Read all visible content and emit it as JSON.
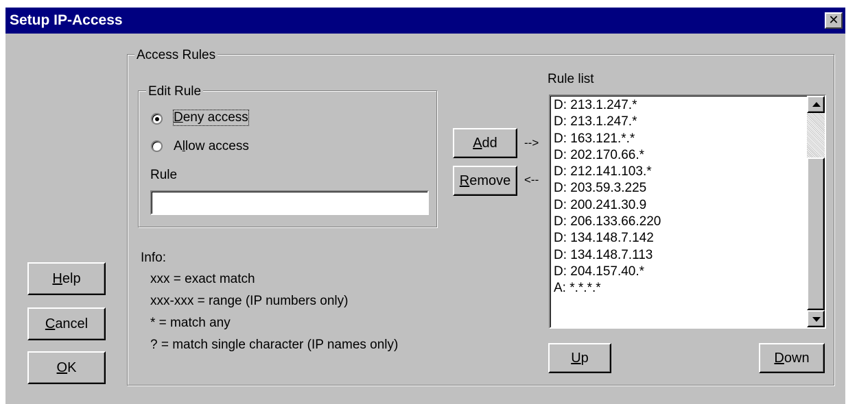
{
  "window": {
    "title": "Setup IP-Access",
    "close_glyph": "✕"
  },
  "buttons": {
    "help": {
      "pre": "",
      "accel": "H",
      "post": "elp"
    },
    "cancel": {
      "pre": "",
      "accel": "C",
      "post": "ancel"
    },
    "ok": {
      "pre": "",
      "accel": "O",
      "post": "K"
    },
    "add": {
      "pre": "",
      "accel": "A",
      "post": "dd"
    },
    "remove": {
      "pre": "",
      "accel": "R",
      "post": "emove"
    },
    "up": {
      "pre": "",
      "accel": "U",
      "post": "p"
    },
    "down": {
      "pre": "",
      "accel": "D",
      "post": "own"
    }
  },
  "access_rules": {
    "label": "Access Rules",
    "edit_rule": {
      "label": "Edit Rule",
      "deny": {
        "pre": "",
        "accel": "D",
        "post": "eny access",
        "selected": true
      },
      "allow": {
        "pre": "A",
        "accel": "l",
        "post": "low access",
        "selected": false
      },
      "rule_label": "Rule",
      "rule_value": ""
    },
    "add_arrow": "-->",
    "remove_arrow": "<--",
    "info": {
      "title": "Info:",
      "lines": [
        "xxx = exact match",
        "xxx-xxx = range (IP numbers only)",
        "* = match any",
        "? = match single character (IP names only)"
      ]
    }
  },
  "rule_list": {
    "label": "Rule list",
    "items": [
      "D: 213.1.247.*",
      "D: 213.1.247.*",
      "D: 163.121.*.*",
      "D: 202.170.66.*",
      "D: 212.141.103.*",
      "D: 203.59.3.225",
      "D: 200.241.30.9",
      "D: 206.133.66.220",
      "D: 134.148.7.142",
      "D: 134.148.7.113",
      "D: 204.157.40.*",
      "A: *.*.*.*"
    ]
  },
  "icons": {
    "close": "close-icon",
    "scroll_up": "arrow-up-icon",
    "scroll_down": "arrow-down-icon"
  },
  "colors": {
    "title_bar": "#000080",
    "face": "#c0c0c0"
  }
}
